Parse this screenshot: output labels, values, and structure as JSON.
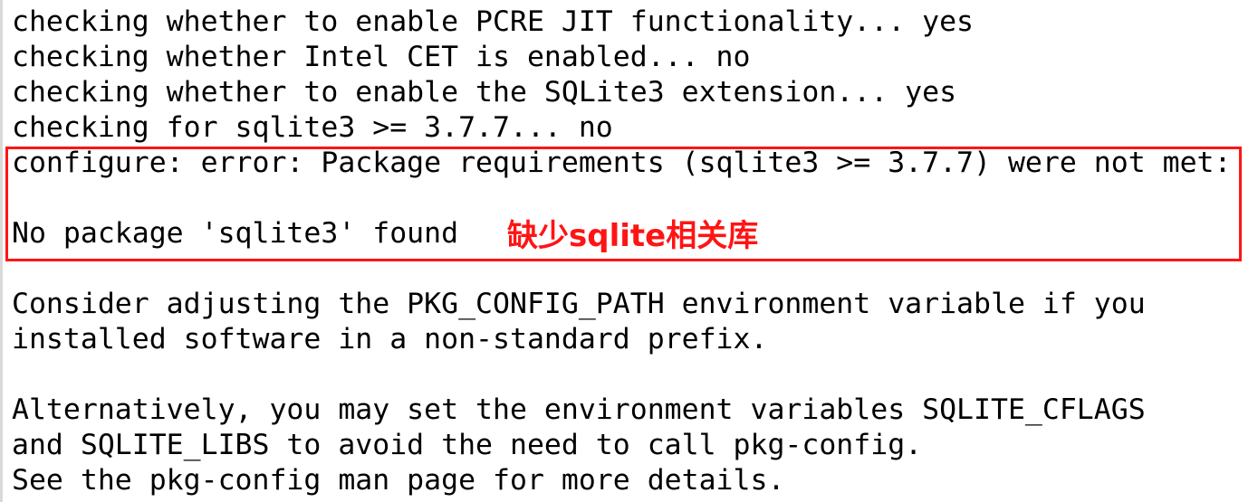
{
  "terminal": {
    "lines": [
      "checking whether to enable PCRE JIT functionality... yes",
      "checking whether Intel CET is enabled... no",
      "checking whether to enable the SQLite3 extension... yes",
      "checking for sqlite3 >= 3.7.7... no",
      "configure: error: Package requirements (sqlite3 >= 3.7.7) were not met:",
      "",
      "No package 'sqlite3' found",
      "",
      "Consider adjusting the PKG_CONFIG_PATH environment variable if you",
      "installed software in a non-standard prefix.",
      "",
      "Alternatively, you may set the environment variables SQLITE_CFLAGS",
      "and SQLITE_LIBS to avoid the need to call pkg-config.",
      "See the pkg-config man page for more details."
    ]
  },
  "annotation": {
    "text": "缺少sqlite相关库",
    "color": "#ff1414"
  },
  "highlight_color": "#ff1414"
}
